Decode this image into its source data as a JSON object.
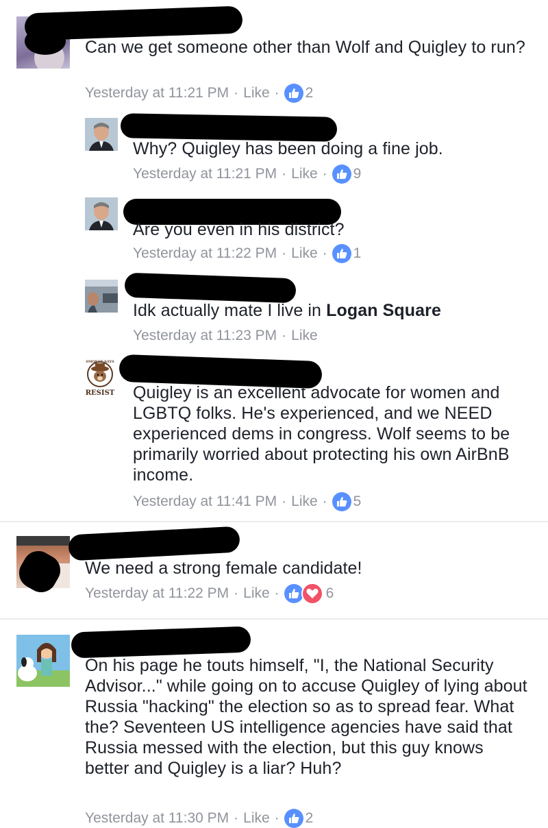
{
  "comments": [
    {
      "text": "Can we get someone other than Wolf and Quigley to run?",
      "time": "Yesterday at 11:21 PM",
      "like": "Like",
      "count": "2"
    },
    {
      "text": "Why? Quigley has been doing a fine job.",
      "time": "Yesterday at 11:21 PM",
      "like": "Like",
      "count": "9"
    },
    {
      "text": "Are you even in his district?",
      "time": "Yesterday at 11:22 PM",
      "like": "Like",
      "count": "1"
    },
    {
      "text_prefix": "Idk actually mate I live in ",
      "text_bold": "Logan Square",
      "time": "Yesterday at 11:23 PM",
      "like": "Like"
    },
    {
      "text": "Quigley is an excellent advocate for women and LGBTQ folks. He's experienced, and we NEED experienced dems in congress. Wolf seems to be primarily worried about protecting his own AirBnB income.",
      "time": "Yesterday at 11:41 PM",
      "like": "Like",
      "count": "5",
      "avatar_text_top": "SMOKEY SAYS",
      "avatar_text_bottom": "RESIST"
    },
    {
      "text": "We need a strong female candidate!",
      "time": "Yesterday at 11:22 PM",
      "like": "Like",
      "count": "6"
    },
    {
      "text": "On his page he touts himself,  \"I, the National Security Advisor...\" while going on to accuse Quigley of lying about Russia \"hacking\" the election so as to spread fear.  What the?  Seventeen US intelligence agencies have said that Russia messed with the election, but this guy knows better and Quigley is a liar?  Huh?",
      "time": "Yesterday at 11:30 PM",
      "like": "Like",
      "count": "2"
    }
  ],
  "colors": {
    "like_blue": "#5890ff",
    "love_red": "#f25268",
    "meta_gray": "#90949c"
  }
}
